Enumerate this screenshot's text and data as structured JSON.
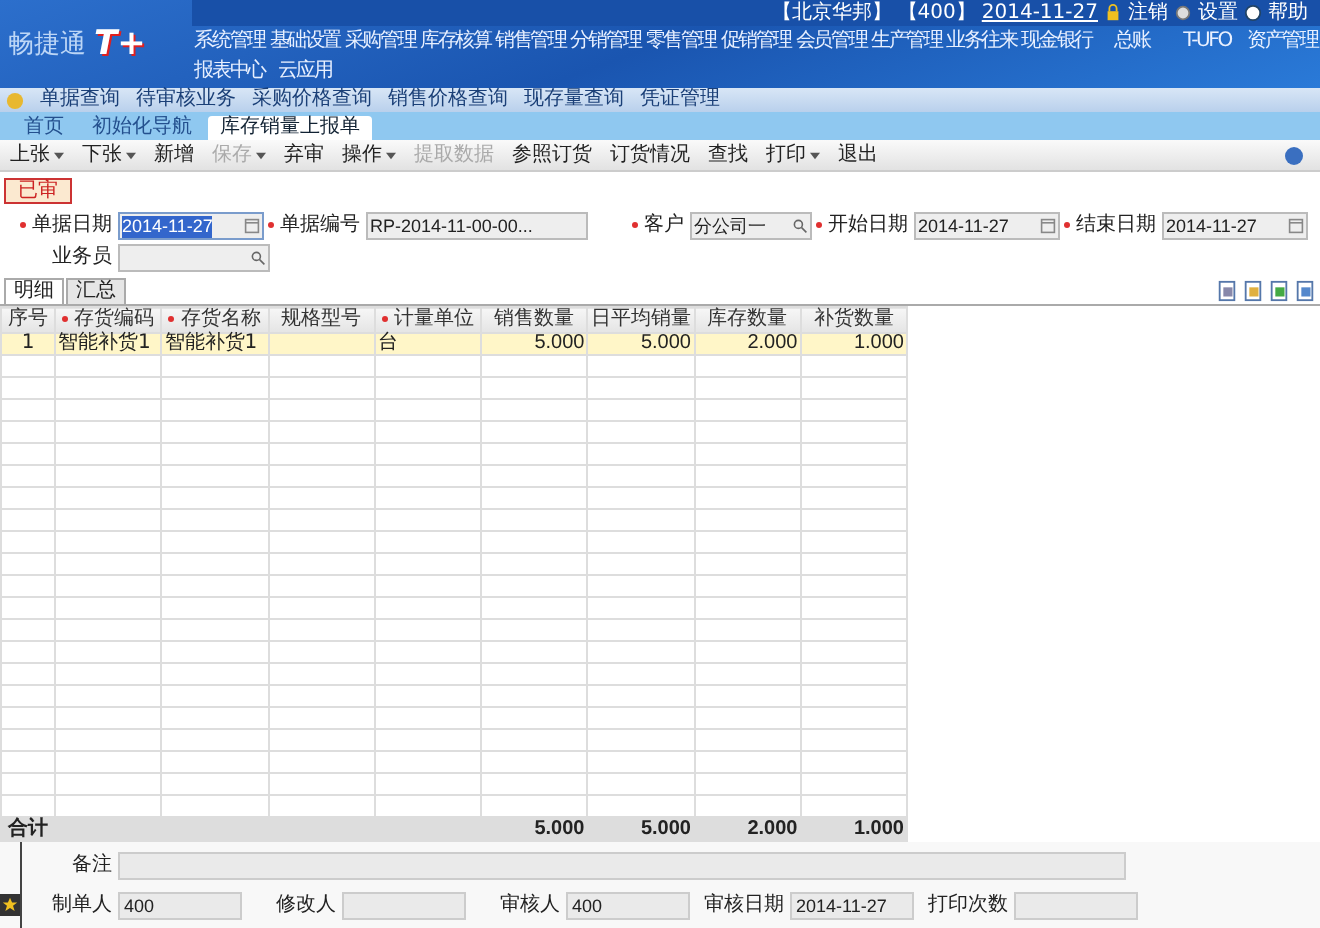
{
  "logo": {
    "name": "畅捷通",
    "mark": "T+"
  },
  "user_bar": {
    "company": "【北京华邦】",
    "user": "【400】",
    "date": "2014-11-27",
    "links": [
      "注销",
      "设置",
      "帮助"
    ]
  },
  "main_menu": [
    [
      "系统管理",
      "基础设置",
      "采购管理",
      "库存核算",
      "销售管理",
      "分销管理",
      "零售管理",
      "促销管理",
      "会员管理",
      "生产管理",
      "业务往来",
      "现金银行",
      "总账",
      "T-UFO",
      "资产管理"
    ],
    [
      "报表中心",
      "云应用"
    ]
  ],
  "quick_links": [
    "单据查询",
    "待审核业务",
    "采购价格查询",
    "销售价格查询",
    "现存量查询",
    "凭证管理"
  ],
  "page_tabs": [
    {
      "label": "首页",
      "selected": false
    },
    {
      "label": "初始化导航",
      "selected": false
    },
    {
      "label": "库存销量上报单",
      "selected": true
    }
  ],
  "toolbar": [
    {
      "label": "上张",
      "dropdown": true,
      "disabled": false
    },
    {
      "label": "下张",
      "dropdown": true,
      "disabled": false
    },
    {
      "label": "新增",
      "dropdown": false,
      "disabled": false
    },
    {
      "label": "保存",
      "dropdown": true,
      "disabled": true
    },
    {
      "label": "弃审",
      "dropdown": false,
      "disabled": false
    },
    {
      "label": "操作",
      "dropdown": true,
      "disabled": false
    },
    {
      "label": "提取数据",
      "dropdown": false,
      "disabled": true
    },
    {
      "label": "参照订货",
      "dropdown": false,
      "disabled": false
    },
    {
      "label": "订货情况",
      "dropdown": false,
      "disabled": false
    },
    {
      "label": "查找",
      "dropdown": false,
      "disabled": false
    },
    {
      "label": "打印",
      "dropdown": true,
      "disabled": false
    },
    {
      "label": "退出",
      "dropdown": false,
      "disabled": false
    }
  ],
  "status_badge": "已审",
  "header_fields": [
    {
      "label": "单据日期",
      "required": true,
      "value": "2014-11-27",
      "kind": "date",
      "highlighted": true
    },
    {
      "label": "单据编号",
      "required": true,
      "value": "RP-2014-11-00-00...",
      "kind": "text",
      "highlighted": false
    },
    {
      "label": "客户",
      "required": true,
      "value": "分公司一",
      "kind": "lookup",
      "highlighted": false
    },
    {
      "label": "开始日期",
      "required": true,
      "value": "2014-11-27",
      "kind": "date",
      "highlighted": false
    },
    {
      "label": "结束日期",
      "required": true,
      "value": "2014-11-27",
      "kind": "date",
      "highlighted": false
    },
    {
      "label": "业务员",
      "required": false,
      "kind": "lookup",
      "highlighted": false
    }
  ],
  "detail_tabs": [
    {
      "label": "明细",
      "selected": true
    },
    {
      "label": "汇总",
      "selected": false
    }
  ],
  "table": {
    "columns": [
      {
        "label": "序号",
        "required": false
      },
      {
        "label": "存货编码",
        "required": true
      },
      {
        "label": "存货名称",
        "required": true
      },
      {
        "label": "规格型号",
        "required": false
      },
      {
        "label": "计量单位",
        "required": true
      },
      {
        "label": "销售数量",
        "required": false
      },
      {
        "label": "日平均销量",
        "required": false
      },
      {
        "label": "库存数量",
        "required": false
      },
      {
        "label": "补货数量",
        "required": false
      }
    ],
    "rows": [
      {
        "selected": true,
        "cells": [
          "1",
          "智能补货1",
          "智能补货1",
          null,
          "台",
          "5.000",
          "5.000",
          "2.000",
          "1.000"
        ]
      }
    ],
    "total": {
      "label": "合计",
      "cells": [
        null,
        null,
        null,
        null,
        "5.000",
        "5.000",
        "2.000",
        "1.000"
      ]
    }
  },
  "footer_fields": [
    {
      "label": "备注",
      "wide": true
    },
    {
      "label": "制单人",
      "value": "400",
      "wide": false
    },
    {
      "label": "修改人",
      "wide": false
    },
    {
      "label": "审核人",
      "value": "400",
      "wide": false
    },
    {
      "label": "审核日期",
      "value": "2014-11-27",
      "wide": false
    },
    {
      "label": "打印次数",
      "wide": false
    }
  ]
}
